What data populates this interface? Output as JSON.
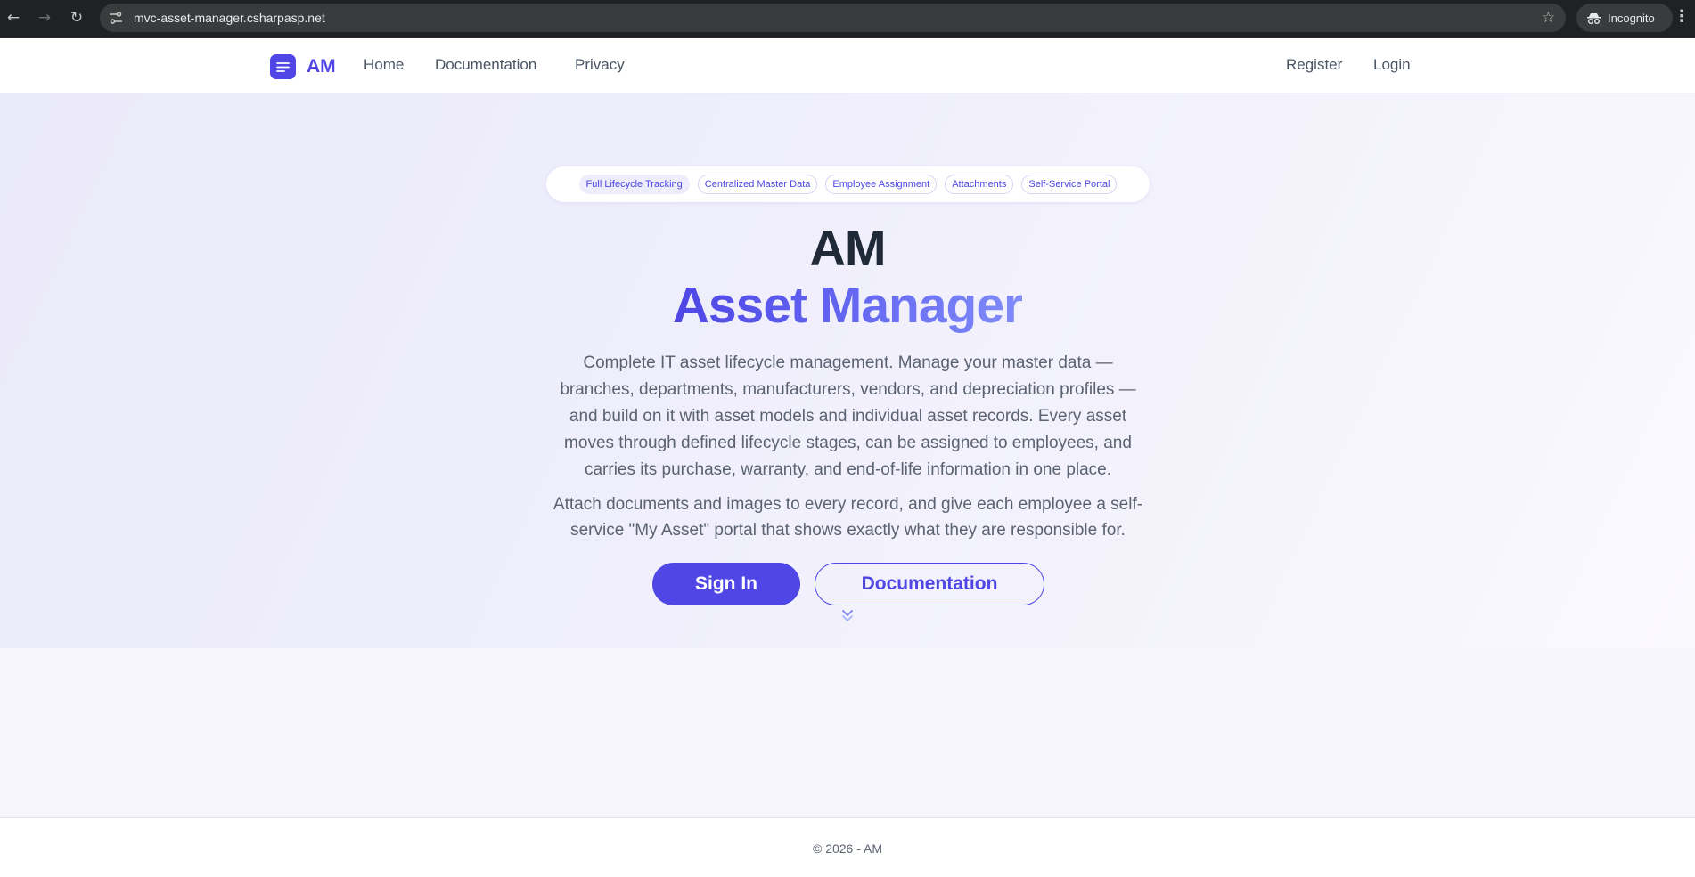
{
  "browser": {
    "url": "mvc-asset-manager.csharpasp.net",
    "incognito_label": "Incognito"
  },
  "header": {
    "brand": "AM",
    "nav": [
      "Home",
      "Documentation",
      "Privacy"
    ],
    "register": "Register",
    "login": "Login"
  },
  "hero": {
    "pills": [
      "Full Lifecycle Tracking",
      "Centralized Master Data",
      "Employee Assignment",
      "Attachments",
      "Self-Service Portal"
    ],
    "title_short": "AM",
    "title_full": "Asset Manager",
    "description": "Complete IT asset lifecycle management. Manage your master data — branches, departments, manufacturers, vendors, and depreciation profiles — and build on it with asset models and individual asset records. Every asset moves through defined lifecycle stages, can be assigned to employees, and carries its purchase, warranty, and end-of-life information in one place.",
    "description_secondary": "Attach documents and images to every record, and give each employee a self-service \"My Asset\" portal that shows exactly what they are responsible for.",
    "signin_label": "Sign In",
    "docs_label": "Documentation"
  },
  "footer": {
    "copyright": "© 2026 - AM"
  },
  "colors": {
    "brand": "#4f46e5",
    "text_dark": "#1f2937",
    "text_muted": "#5b6271"
  }
}
